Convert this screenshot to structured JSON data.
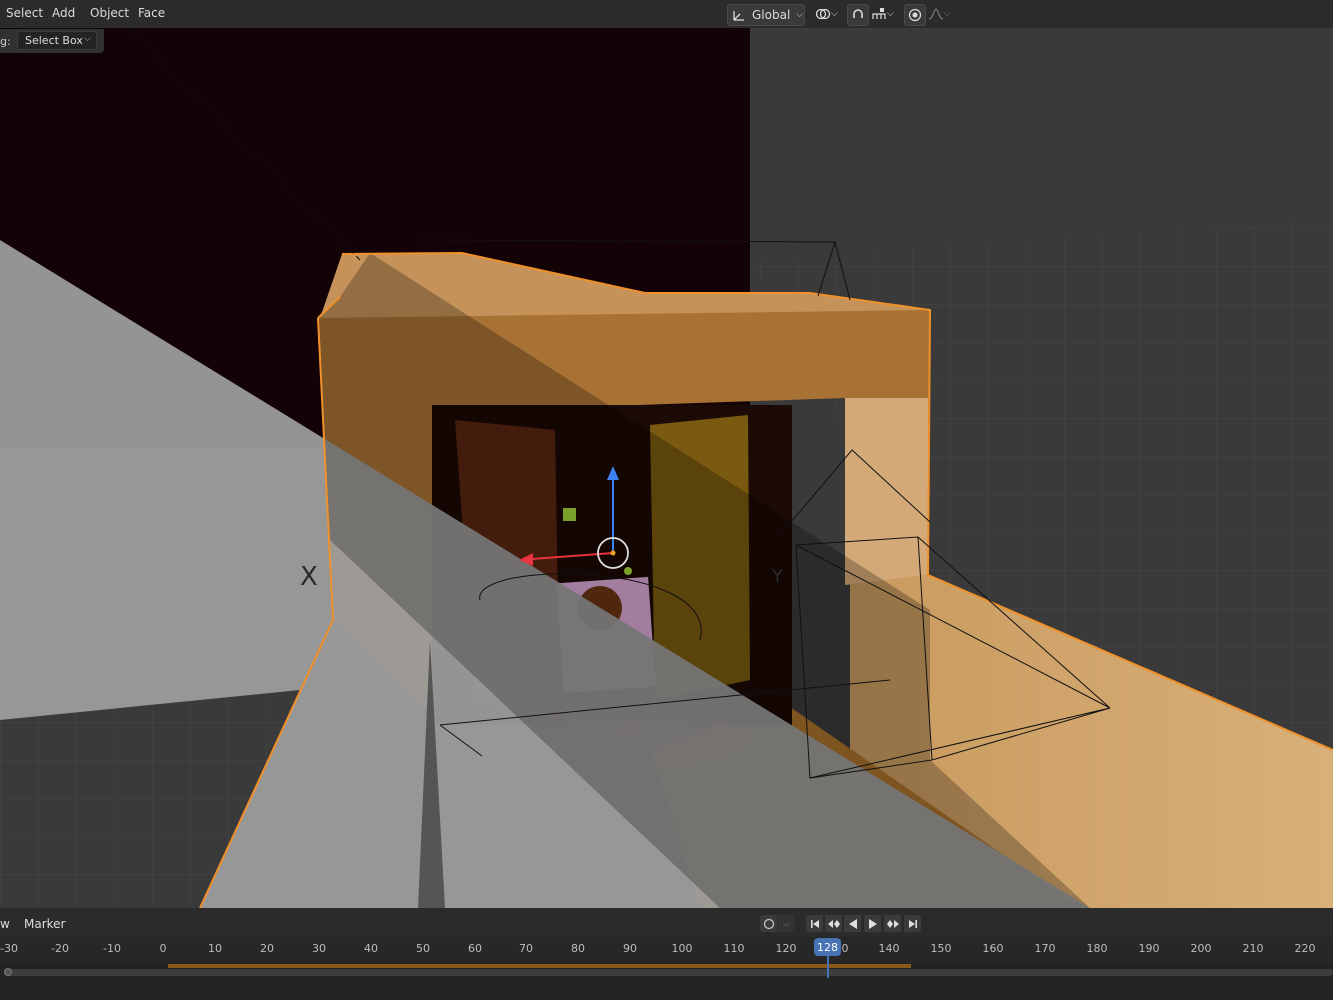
{
  "header": {
    "menus": [
      "Select",
      "Add",
      "Object",
      "Face"
    ],
    "orientation": "Global",
    "icons": [
      "transform-orientation-icon",
      "pivot-icon",
      "snap-icon",
      "snap-target-icon",
      "proportional-edit-icon",
      "falloff-icon"
    ]
  },
  "tool_options": {
    "label": "g:",
    "select_mode": "Select Box"
  },
  "viewport": {
    "colors": {
      "background": "#3d3d3d",
      "selected_outline": "#f0902a",
      "object_orange": "#c8914d",
      "backdrop": "#130306",
      "floor_grey": "#9a9a9a"
    },
    "axis_labels": [
      "X",
      "Y"
    ]
  },
  "timeline": {
    "menus": [
      "w",
      "Marker"
    ],
    "current_frame": "128",
    "ticks": [
      "-30",
      "-20",
      "-10",
      "0",
      "10",
      "20",
      "30",
      "40",
      "50",
      "60",
      "70",
      "80",
      "90",
      "100",
      "110",
      "120",
      "130",
      "140",
      "150",
      "160",
      "170",
      "180",
      "190",
      "200",
      "210",
      "220"
    ],
    "playback_icons": [
      "jump-start-icon",
      "prev-keyframe-icon",
      "play-reverse-icon",
      "play-icon",
      "next-keyframe-icon",
      "jump-end-icon"
    ]
  }
}
